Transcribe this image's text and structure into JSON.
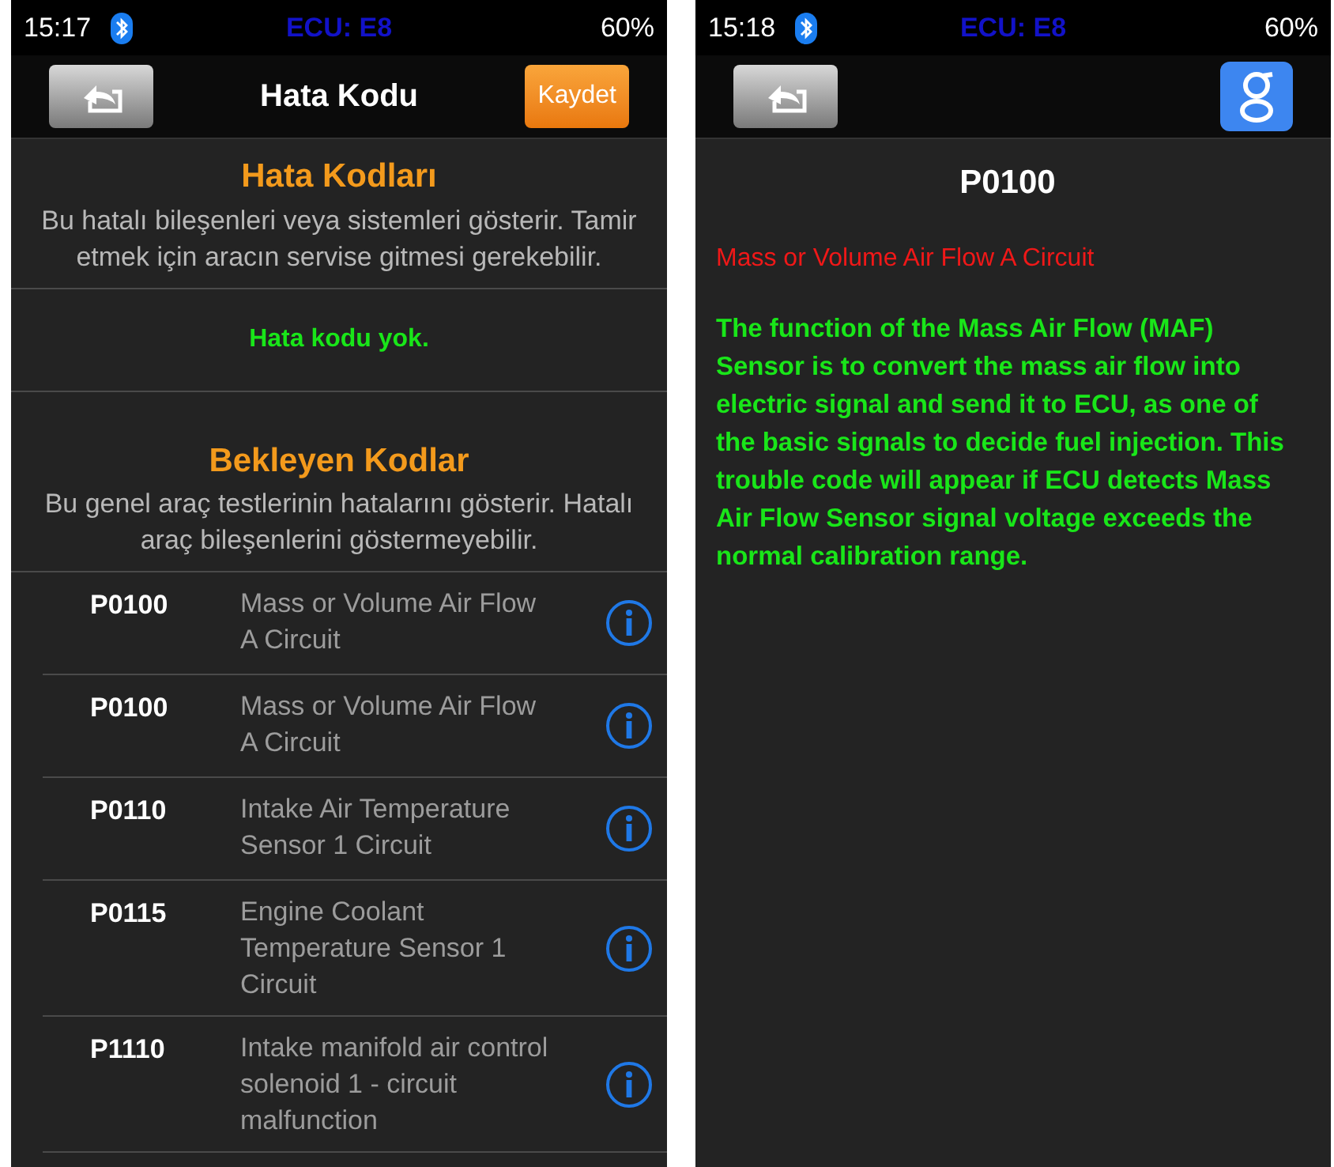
{
  "screens": [
    {
      "status_bar": {
        "time": "15:17",
        "ecu": "ECU: E8",
        "battery": "60%"
      },
      "nav": {
        "title": "Hata Kodu",
        "right": {
          "kind": "button",
          "label": "Kaydet"
        }
      },
      "sections": [
        {
          "kind": "header",
          "title": "Hata Kodları",
          "description": "Bu hatalı bileşenleri veya sistemleri gösterir. Tamir etmek için aracın servise gitmesi gerekebilir."
        },
        {
          "kind": "message",
          "text": "Hata kodu yok."
        },
        {
          "kind": "header",
          "title": "Bekleyen Kodlar",
          "description": "Bu genel araç testlerinin hatalarını gösterir. Hatalı araç bileşenlerini göstermeyebilir."
        }
      ],
      "codes": [
        {
          "code": "P0100",
          "description": "Mass or Volume Air Flow A Circuit"
        },
        {
          "code": "P0100",
          "description": "Mass or Volume Air Flow A Circuit"
        },
        {
          "code": "P0110",
          "description": "Intake Air Temperature Sensor 1 Circuit"
        },
        {
          "code": "P0115",
          "description": "Engine Coolant Temperature Sensor 1 Circuit"
        },
        {
          "code": "P1110",
          "description": "Intake manifold air control solenoid 1 - circuit malfunction"
        }
      ]
    },
    {
      "status_bar": {
        "time": "15:18",
        "ecu": "ECU: E8",
        "battery": "60%"
      },
      "nav": {
        "right": {
          "kind": "logo"
        }
      },
      "detail": {
        "code": "P0100",
        "name": "Mass or Volume Air Flow A Circuit",
        "text": "The function of the Mass Air Flow (MAF) Sensor is to convert the mass air flow into electric signal and send it to ECU, as one of the basic signals to decide fuel injection. This trouble code will appear if ECU detects Mass Air Flow Sensor signal voltage exceeds the normal calibration range."
      }
    }
  ]
}
